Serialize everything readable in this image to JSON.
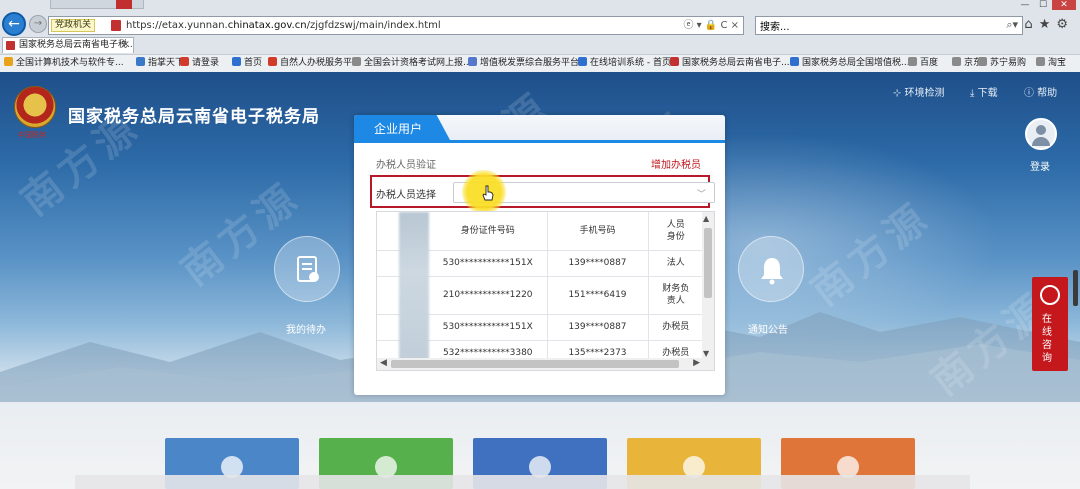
{
  "browser": {
    "compat_label": "党政机关",
    "url_prefix": "https://etax.yunnan.",
    "url_domain": "chinatax.gov.cn",
    "url_path": "/zjgfdzswj/main/index.html",
    "url_tools": "ⓔ ▾ 🔒 C ×",
    "search_value": "搜索...",
    "tab_title": "国家税务总局云南省电子税...",
    "favorites": [
      "全国计算机技术与软件专...",
      "指掌天下",
      "请登录",
      "首页",
      "自然人办税服务平...",
      "全国会计资格考试网上报...",
      "增值税发票综合服务平台",
      "在线培训系统 - 首页",
      "国家税务总局云南省电子...",
      "国家税务总局全国增值税...",
      "百度",
      "京东",
      "苏宁易购",
      "淘宝"
    ],
    "fav_colors": [
      "#e8a21c",
      "#3a78c8",
      "#d23a2a",
      "#2e6fd0",
      "#d23a2a",
      "#8a8a8a",
      "#5577cc",
      "#2e6fd0",
      "#c23030",
      "#2e6fd0",
      "#8a8a8a",
      "#8a8a8a",
      "#8a8a8a",
      "#8a8a8a"
    ]
  },
  "site": {
    "emblem_caption": "中国税务",
    "title": "国家税务总局云南省电子税务局",
    "links": [
      "⊹ 环境检测",
      "⤓ 下载",
      "ⓘ 帮助"
    ],
    "login": "登录",
    "my_todo": "我的待办",
    "notice": "通知公告",
    "consult": "在线咨询",
    "watermark": "南方源",
    "tile_colors": [
      "#4a86c8",
      "#56b04b",
      "#3f71c0",
      "#e8b43a",
      "#e0753a"
    ]
  },
  "modal": {
    "tab": "企业用户",
    "verify_label": "办税人员验证",
    "add_link": "增加办税员",
    "select_label": "办税人员选择",
    "select_value": "",
    "columns": [
      "身份证件号码",
      "手机号码",
      "人员身份"
    ],
    "rows": [
      {
        "id": "530***********151X",
        "phone": "139****0887",
        "role": "法人"
      },
      {
        "id": "210***********1220",
        "phone": "151****6419",
        "role": "财务负责人"
      },
      {
        "id": "530***********151X",
        "phone": "139****0887",
        "role": "办税员"
      },
      {
        "id": "532***********3380",
        "phone": "135****2373",
        "role": "办税员"
      }
    ]
  }
}
